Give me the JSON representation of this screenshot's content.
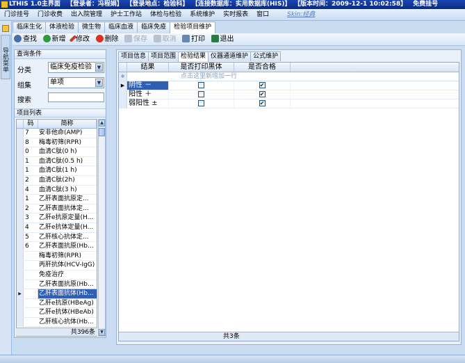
{
  "titlebar": {
    "app": "LTHIS 1.0主界面",
    "user": "【登录者：冯程娟】",
    "location": "【登录地点：检验科】",
    "db": "【连接数据库：实用数据库(HIS)】",
    "version": "【版本时间：2009-12-1 10:02:58】",
    "reg": "免费挂号"
  },
  "menu": [
    "门诊挂号",
    "门诊收费",
    "出入院管理",
    "护士工作站",
    "体检与检验",
    "系统维护",
    "实时报表",
    "窗口"
  ],
  "skin_link": "Skin:经典",
  "side_tab": "导航菜单",
  "tabs": [
    "临床生化",
    "体液检验",
    "微生物",
    "临床血液",
    "临床免疫",
    "检验项目维护"
  ],
  "active_tab_index": 5,
  "toolbar": {
    "find": "查找",
    "add": "新增",
    "edit": "修改",
    "delete": "删除",
    "save": "保存",
    "cancel": "取消",
    "print": "打印",
    "exit": "退出"
  },
  "query": {
    "title": "查询条件",
    "category_label": "分类",
    "category_value": "临床免疫检验",
    "group_label": "组集",
    "group_value": "单项",
    "search_label": "搜索",
    "search_value": ""
  },
  "item_list": {
    "title": "项目列表",
    "col_code": "码",
    "col_name": "简称",
    "rows": [
      {
        "code": "7",
        "name": "安非他命(AMP)"
      },
      {
        "code": "8",
        "name": "梅毒初筛(RPR)"
      },
      {
        "code": "0",
        "name": "血清C肽(0 h)"
      },
      {
        "code": "1",
        "name": "血清C肽(0.5 h)"
      },
      {
        "code": "1",
        "name": "血清C肽(1 h)"
      },
      {
        "code": "2",
        "name": "血清C肽(2h)"
      },
      {
        "code": "4",
        "name": "血清C肽(3 h)"
      },
      {
        "code": "1",
        "name": "乙肝表面抗原定..."
      },
      {
        "code": "2",
        "name": "乙肝表面抗体定..."
      },
      {
        "code": "3",
        "name": "乙肝e抗原定量(H..."
      },
      {
        "code": "4",
        "name": "乙肝e抗体定量(H..."
      },
      {
        "code": "5",
        "name": "乙肝核心抗体定..."
      },
      {
        "code": "6",
        "name": "乙肝表面抗原(Hb..."
      },
      {
        "code": "",
        "name": "梅毒初筛(RPR)"
      },
      {
        "code": "",
        "name": "丙肝抗体(HCV-IgG)"
      },
      {
        "code": "",
        "name": "免疫治疗"
      },
      {
        "code": "",
        "name": "乙肝表面抗原(Hb..."
      },
      {
        "code": "",
        "name": "乙肝表面抗体(Hb..."
      },
      {
        "code": "",
        "name": "乙肝e抗原(HBeAg)"
      },
      {
        "code": "",
        "name": "乙肝e抗体(HBeAb)"
      },
      {
        "code": "",
        "name": "乙肝核心抗体(Hb..."
      }
    ],
    "selected_index": 17,
    "total": "共396条"
  },
  "detail_tabs": [
    "项目信息",
    "项目范围",
    "检验结果",
    "仪器通道维护",
    "公式维护"
  ],
  "active_detail_tab": 2,
  "results": {
    "col_result": "结果",
    "col_print_black": "是否打印黑体",
    "col_qualified": "是否合格",
    "new_row_hint": "点击这里新增加一行",
    "rows": [
      {
        "result": "阴性 －",
        "print_black": false,
        "qualified": true
      },
      {
        "result": "阳性 ＋",
        "print_black": false,
        "qualified": true
      },
      {
        "result": "弱阳性 ±",
        "print_black": false,
        "qualified": true
      }
    ],
    "total": "共3条"
  }
}
